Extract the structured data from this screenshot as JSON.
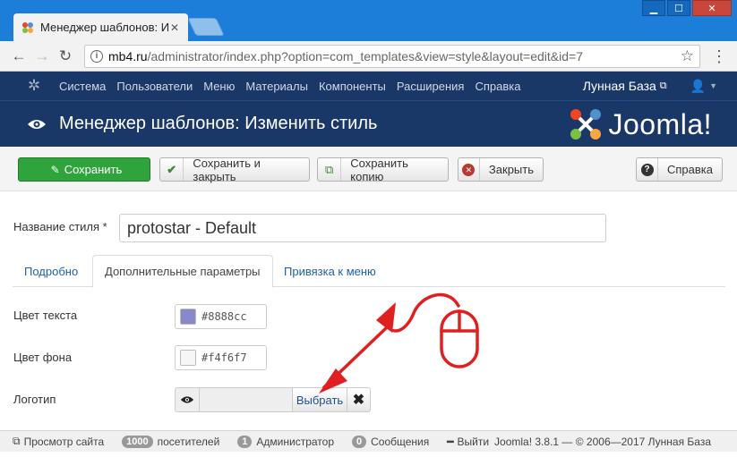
{
  "browser": {
    "tab_title": "Менеджер шаблонов: И",
    "url_host": "mb4.ru",
    "url_path": "/administrator/index.php?option=com_templates&view=style&layout=edit&id=7"
  },
  "admin_nav": {
    "menu": [
      "Система",
      "Пользователи",
      "Меню",
      "Материалы",
      "Компоненты",
      "Расширения",
      "Справка"
    ],
    "site_name": "Лунная База"
  },
  "header": {
    "title": "Менеджер шаблонов: Изменить стиль",
    "logo_text": "Joomla!"
  },
  "toolbar": {
    "save": "Сохранить",
    "save_close": "Сохранить и закрыть",
    "save_copy": "Сохранить копию",
    "close": "Закрыть",
    "help": "Справка"
  },
  "form": {
    "style_label": "Название стиля *",
    "style_value": "protostar - Default",
    "tabs": [
      "Подробно",
      "Дополнительные параметры",
      "Привязка к меню"
    ],
    "active_tab": "Дополнительные параметры",
    "text_color_label": "Цвет текста",
    "text_color_value": "#8888cc",
    "bg_color_label": "Цвет фона",
    "bg_color_value": "#f4f6f7",
    "logo_label": "Логотип",
    "select_label": "Выбрать",
    "clear_label": "✖"
  },
  "statusbar": {
    "view_site": "Просмотр сайта",
    "visitors_count": "1000",
    "visitors_label": "посетителей",
    "admins_count": "1",
    "admins_label": "Администратор",
    "messages_count": "0",
    "messages_label": "Сообщения",
    "logout": "Выйти",
    "version": "Joomla! 3.8.1  —  © 2006—2017 Лунная База"
  },
  "colors": {
    "navbar": "#1a3867",
    "browser": "#1c7ed8",
    "save_green": "#2fa43d",
    "annotation_red": "#e02020"
  }
}
